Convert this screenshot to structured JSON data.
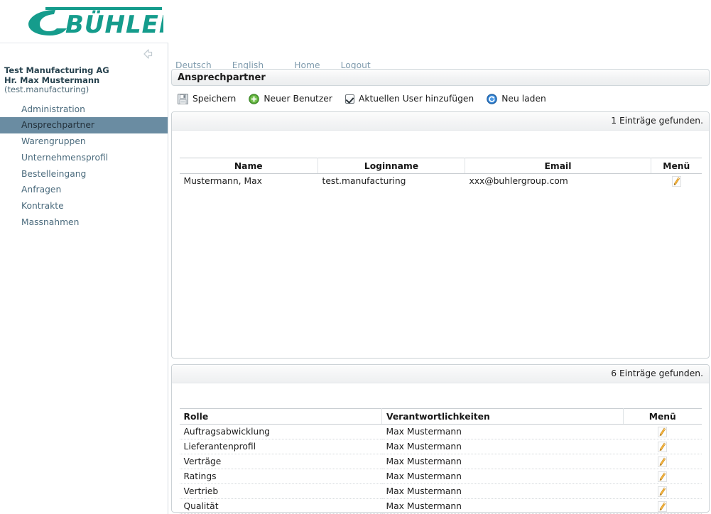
{
  "brand": {
    "name": "BÜHLER",
    "color": "#159c8c"
  },
  "sidebar": {
    "collapse_icon": "collapse-left-arrow-icon",
    "org": {
      "company": "Test Manufacturing AG",
      "person": "Hr. Max Mustermann",
      "login": "(test.manufacturing)"
    },
    "items": [
      {
        "label": "Administration",
        "selected": false
      },
      {
        "label": "Ansprechpartner",
        "selected": true
      },
      {
        "label": "Warengruppen",
        "selected": false
      },
      {
        "label": "Unternehmensprofil",
        "selected": false
      },
      {
        "label": "Bestelleingang",
        "selected": false
      },
      {
        "label": "Anfragen",
        "selected": false
      },
      {
        "label": "Kontrakte",
        "selected": false
      },
      {
        "label": "Massnahmen",
        "selected": false
      }
    ]
  },
  "topnav": [
    {
      "label": "Deutsch"
    },
    {
      "label": "English"
    },
    {
      "label": "Home"
    },
    {
      "label": "Logout"
    }
  ],
  "page": {
    "title": "Ansprechpartner"
  },
  "toolbar": {
    "save_label": "Speichern",
    "new_user_label": "Neuer Benutzer",
    "add_current_user_label": "Aktuellen User hinzufügen",
    "add_current_user_checked": true,
    "reload_label": "Neu laden",
    "icons": {
      "save": "floppy-disk-icon",
      "new_user": "green-plus-circle-icon",
      "checkbox": "checkbox-checked-icon",
      "reload": "blue-refresh-circle-icon"
    }
  },
  "users_panel": {
    "count_text": "1 Einträge gefunden.",
    "columns": [
      "Name",
      "Loginname",
      "Email",
      "Menü"
    ],
    "rows": [
      {
        "name": "Mustermann, Max",
        "loginname": "test.manufacturing",
        "email": "xxx@buhlergroup.com",
        "menu_icon": "edit-pencil-icon"
      }
    ]
  },
  "roles_panel": {
    "count_text": "6 Einträge gefunden.",
    "columns": [
      "Rolle",
      "Verantwortlichkeiten",
      "Menü"
    ],
    "rows": [
      {
        "rolle": "Auftragsabwicklung",
        "verantwortlichkeiten": "Max Mustermann",
        "menu_icon": "edit-pencil-icon"
      },
      {
        "rolle": "Lieferantenprofil",
        "verantwortlichkeiten": "Max Mustermann",
        "menu_icon": "edit-pencil-icon"
      },
      {
        "rolle": "Verträge",
        "verantwortlichkeiten": "Max Mustermann",
        "menu_icon": "edit-pencil-icon"
      },
      {
        "rolle": "Ratings",
        "verantwortlichkeiten": "Max Mustermann",
        "menu_icon": "edit-pencil-icon"
      },
      {
        "rolle": "Vertrieb",
        "verantwortlichkeiten": "Max Mustermann",
        "menu_icon": "edit-pencil-icon"
      },
      {
        "rolle": "Qualität",
        "verantwortlichkeiten": "Max Mustermann",
        "menu_icon": "edit-pencil-icon"
      }
    ]
  }
}
